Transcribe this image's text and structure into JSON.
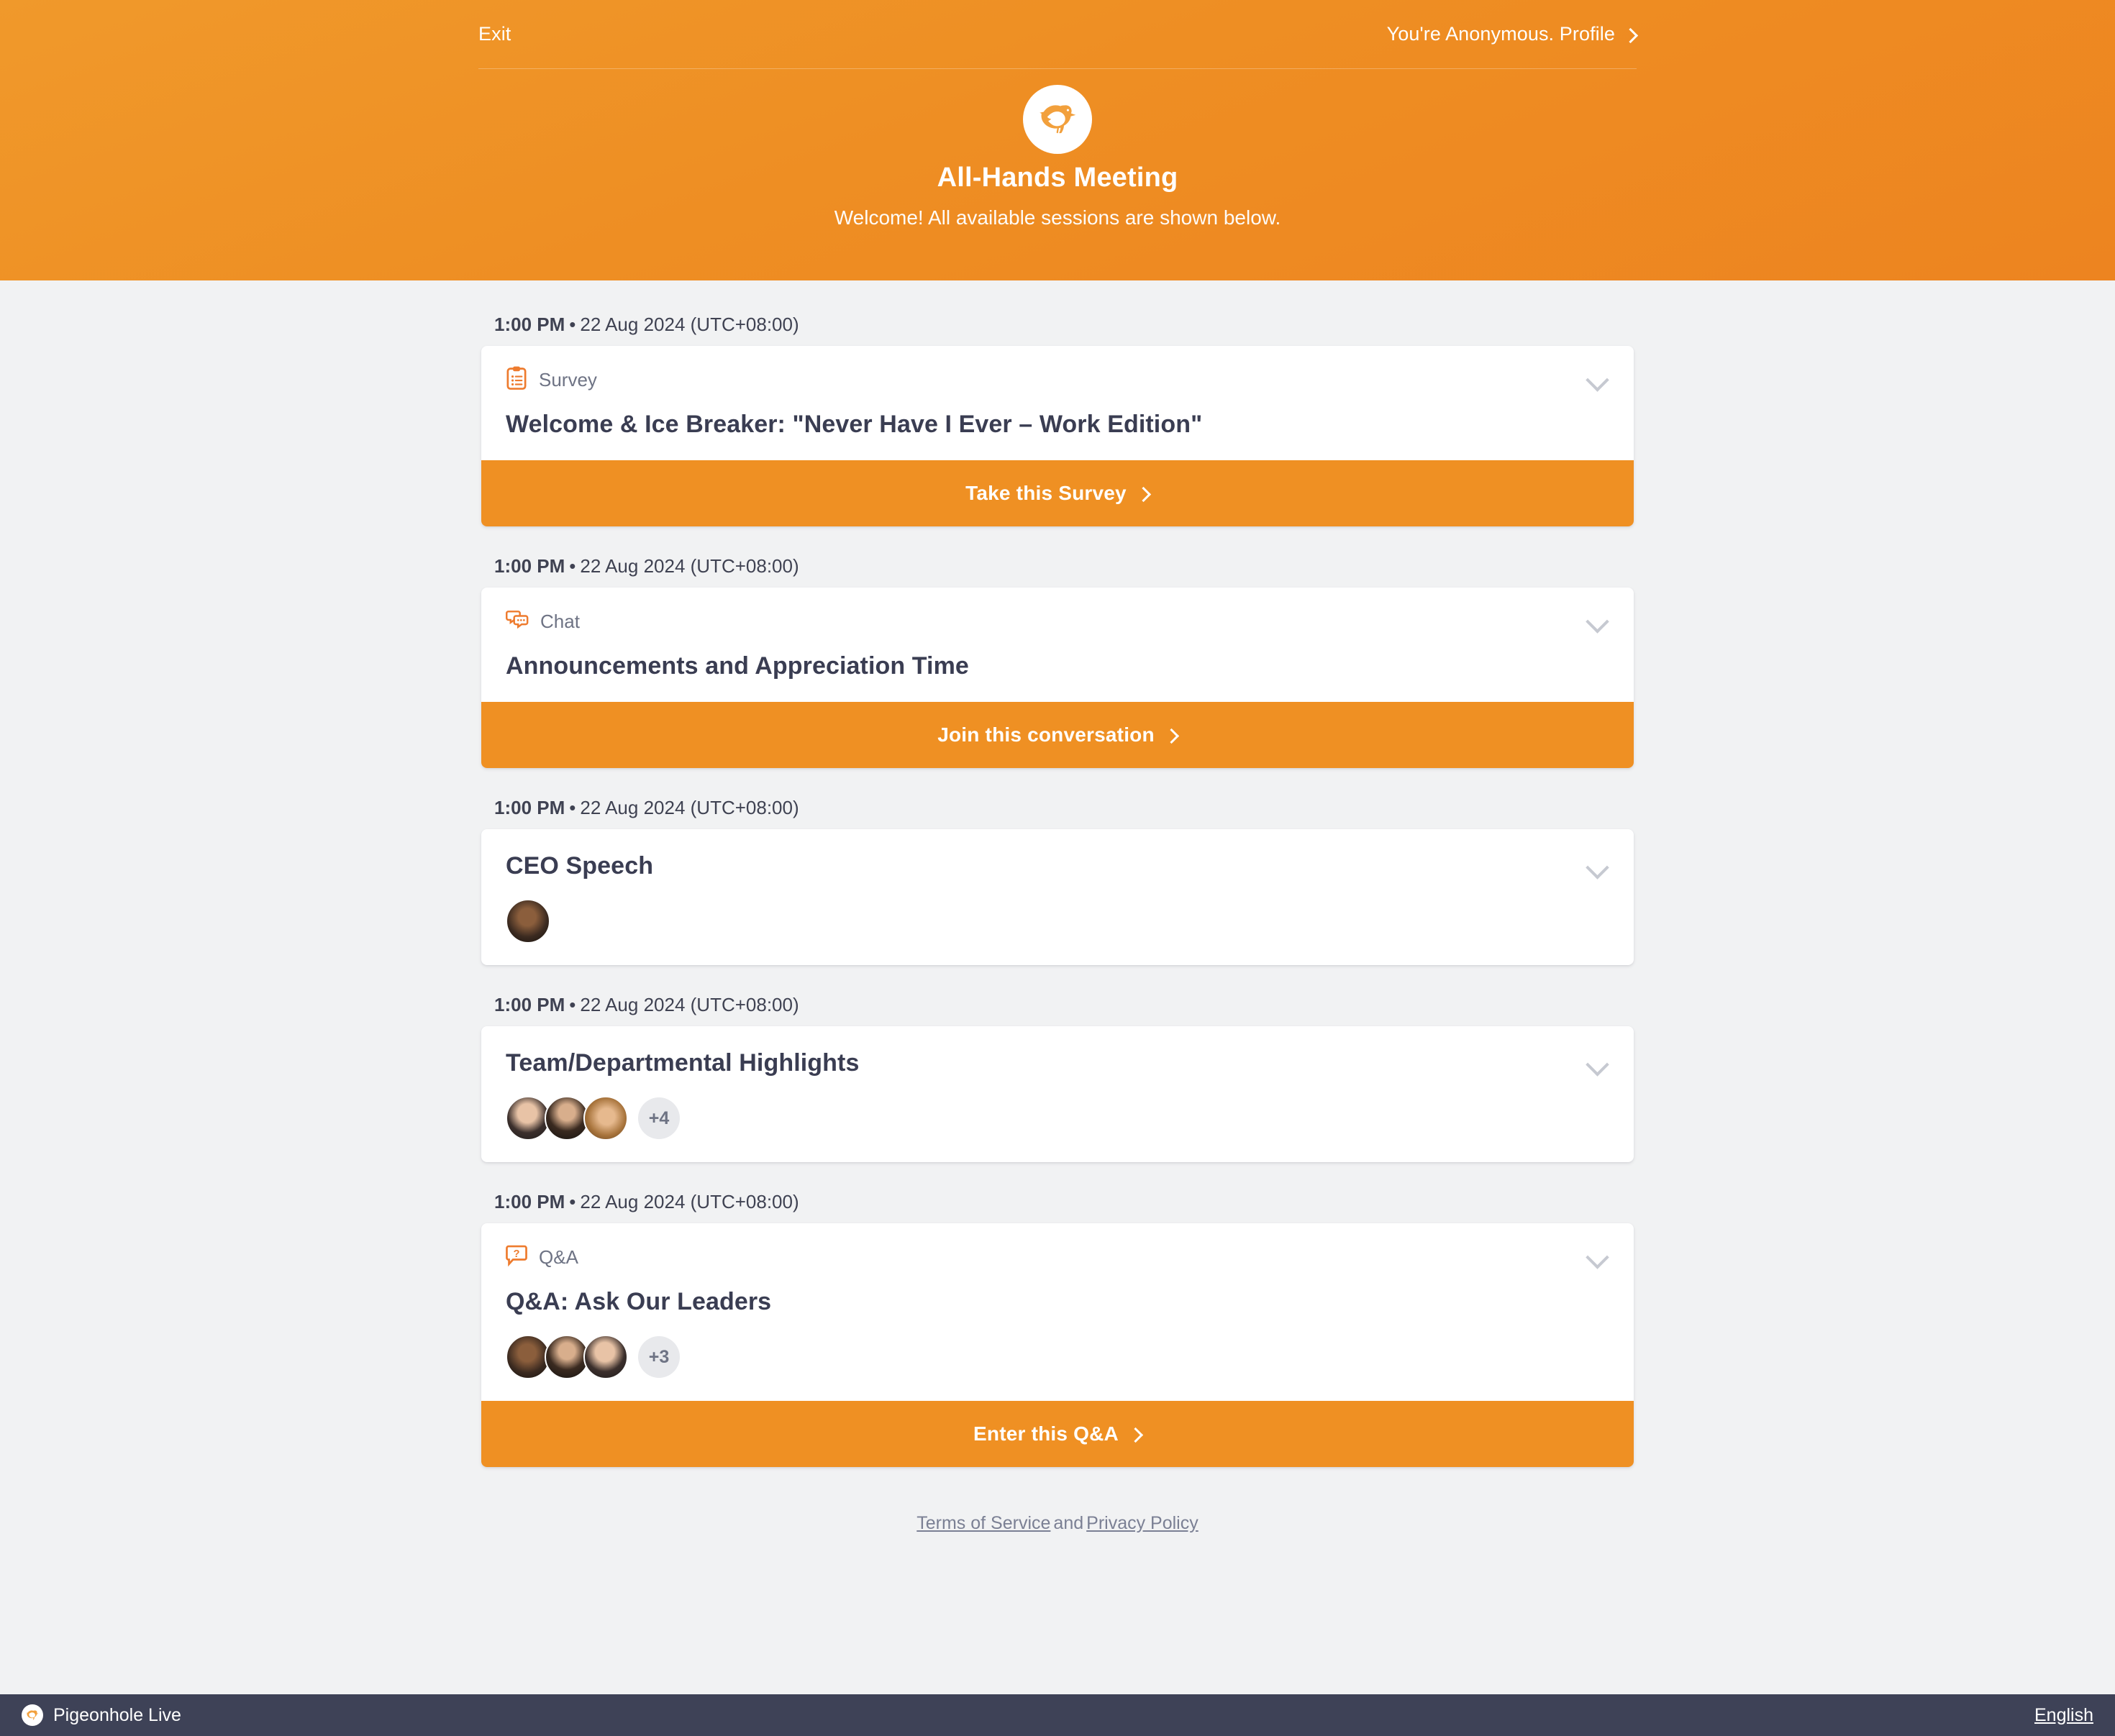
{
  "topnav": {
    "exit_label": "Exit",
    "profile_label": "You're Anonymous. Profile",
    "chevron_icon": "chevron-right-icon"
  },
  "header": {
    "logo_icon": "pigeon-logo-icon",
    "title": "All-Hands Meeting",
    "subtitle": "Welcome! All available sessions are shown below.",
    "accent_color": "#ef9023"
  },
  "sessions": [
    {
      "time_bold": "1:00 PM",
      "time_rest": "22 Aug 2024 (UTC+08:00)",
      "type": "Survey",
      "type_icon": "clipboard-survey-icon",
      "title": "Welcome & Ice Breaker: \"Never Have I Ever – Work Edition\"",
      "cta": "Take this Survey",
      "avatars": [],
      "avatar_more": ""
    },
    {
      "time_bold": "1:00 PM",
      "time_rest": "22 Aug 2024 (UTC+08:00)",
      "type": "Chat",
      "type_icon": "chat-bubbles-icon",
      "title": "Announcements and Appreciation Time",
      "cta": "Join this conversation",
      "avatars": [],
      "avatar_more": ""
    },
    {
      "time_bold": "1:00 PM",
      "time_rest": "22 Aug 2024 (UTC+08:00)",
      "type": "",
      "type_icon": "",
      "title": "CEO Speech",
      "cta": "",
      "avatars": [
        "av4"
      ],
      "avatar_more": ""
    },
    {
      "time_bold": "1:00 PM",
      "time_rest": "22 Aug 2024 (UTC+08:00)",
      "type": "",
      "type_icon": "",
      "title": "Team/Departmental Highlights",
      "cta": "",
      "avatars": [
        "av1",
        "av2",
        "av3"
      ],
      "avatar_more": "+4"
    },
    {
      "time_bold": "1:00 PM",
      "time_rest": "22 Aug 2024 (UTC+08:00)",
      "type": "Q&A",
      "type_icon": "question-bubble-icon",
      "title": "Q&A: Ask Our Leaders",
      "cta": "Enter this Q&A",
      "avatars": [
        "av4",
        "av2",
        "av1"
      ],
      "avatar_more": "+3"
    }
  ],
  "footer": {
    "terms_label": "Terms of Service",
    "and_label": "and",
    "privacy_label": "Privacy Policy",
    "brand_label": "Pigeonhole Live",
    "brand_icon": "pigeon-logo-icon",
    "language_label": "English"
  }
}
